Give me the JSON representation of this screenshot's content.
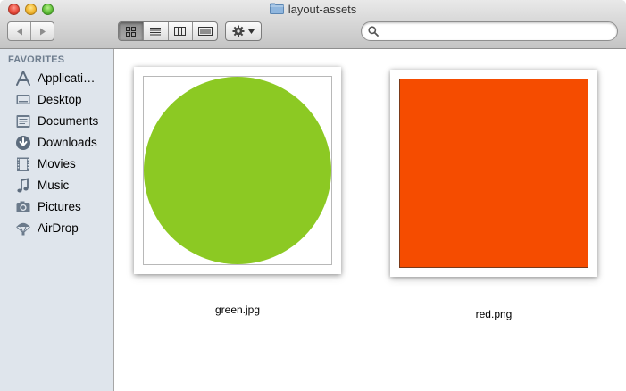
{
  "window": {
    "title": "layout-assets"
  },
  "toolbar": {
    "back_icon": "back-arrow-icon",
    "forward_icon": "forward-arrow-icon",
    "views": [
      "icon-view",
      "list-view",
      "column-view",
      "coverflow-view"
    ],
    "active_view": "icon-view",
    "action_icon": "gear-icon",
    "search": {
      "placeholder": "",
      "value": ""
    }
  },
  "sidebar": {
    "heading": "FAVORITES",
    "items": [
      {
        "label": "Applicati…",
        "icon": "applications-icon"
      },
      {
        "label": "Desktop",
        "icon": "desktop-icon"
      },
      {
        "label": "Documents",
        "icon": "documents-icon"
      },
      {
        "label": "Downloads",
        "icon": "downloads-icon"
      },
      {
        "label": "Movies",
        "icon": "movies-icon"
      },
      {
        "label": "Music",
        "icon": "music-icon"
      },
      {
        "label": "Pictures",
        "icon": "pictures-icon"
      },
      {
        "label": "AirDrop",
        "icon": "airdrop-icon"
      }
    ]
  },
  "files": [
    {
      "name": "green.jpg",
      "color": "#8cc923",
      "shape": "circle"
    },
    {
      "name": "red.png",
      "color": "#f54c00",
      "shape": "square"
    }
  ],
  "colors": {
    "sidebar_bg": "#dfe5ec",
    "sidebar_heading": "#6f7e8f",
    "green": "#8cc923",
    "red": "#f54c00"
  }
}
